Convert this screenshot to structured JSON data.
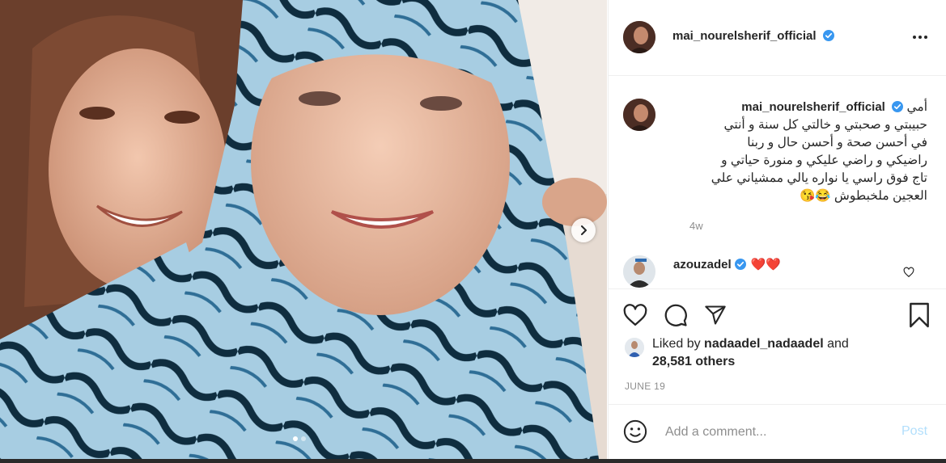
{
  "post": {
    "author": "mai_nourelsherif_official",
    "verified_icon": "verified-badge-icon",
    "more_icon": "more-options-icon"
  },
  "caption": {
    "author": "mai_nourelsherif_official",
    "first_word": "أمي",
    "lines": [
      "حبيبتي و صحبتي و خالتي كل سنة و أنتي",
      "في أحسن صحة و أحسن حال و ربنا",
      "راضيكي و راضي عليكي و منورة حياتي و",
      "تاج فوق راسي يا نواره يالي ممشياني علي",
      "العجين ملخبطوش 😂😘"
    ],
    "time_ago": "4w"
  },
  "comment": {
    "author": "azouzadel",
    "text": "❤️❤️"
  },
  "likes": {
    "prefix": "Liked by",
    "user": "nadaadel_nadaadel",
    "and": "and",
    "others": "28,581 others"
  },
  "date": "JUNE 19",
  "add_comment": {
    "placeholder": "Add a comment...",
    "post_label": "Post"
  },
  "carousel": {
    "slides": 2,
    "current": 1
  },
  "colors": {
    "verified": "#3897f0",
    "heart": "#ed4956",
    "post_disabled": "#b2dffc",
    "muted": "#8e8e8e"
  }
}
